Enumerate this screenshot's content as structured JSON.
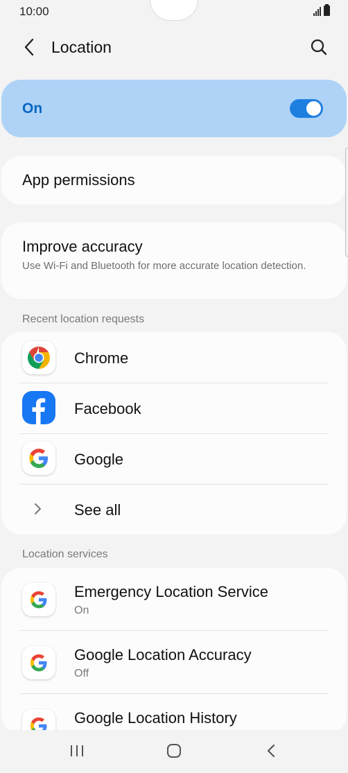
{
  "status_bar": {
    "time": "10:00"
  },
  "header": {
    "title": "Location"
  },
  "master": {
    "label": "On",
    "enabled": true
  },
  "app_permissions": {
    "title": "App permissions"
  },
  "improve_accuracy": {
    "title": "Improve accuracy",
    "subtitle": "Use Wi-Fi and Bluetooth for more accurate location detection."
  },
  "recent_requests": {
    "header": "Recent location requests",
    "items": [
      {
        "label": "Chrome",
        "icon": "chrome-icon"
      },
      {
        "label": "Facebook",
        "icon": "facebook-icon"
      },
      {
        "label": "Google",
        "icon": "google-icon"
      }
    ],
    "see_all": "See all"
  },
  "location_services": {
    "header": "Location services",
    "items": [
      {
        "label": "Emergency Location Service",
        "status": "On",
        "icon": "google-icon"
      },
      {
        "label": "Google Location Accuracy",
        "status": "Off",
        "icon": "google-icon"
      },
      {
        "label": "Google Location History",
        "status": "",
        "icon": "google-icon"
      }
    ]
  },
  "colors": {
    "accent": "#1f7fe0",
    "master_bg": "#aed3f7",
    "master_text": "#0a66c2"
  }
}
